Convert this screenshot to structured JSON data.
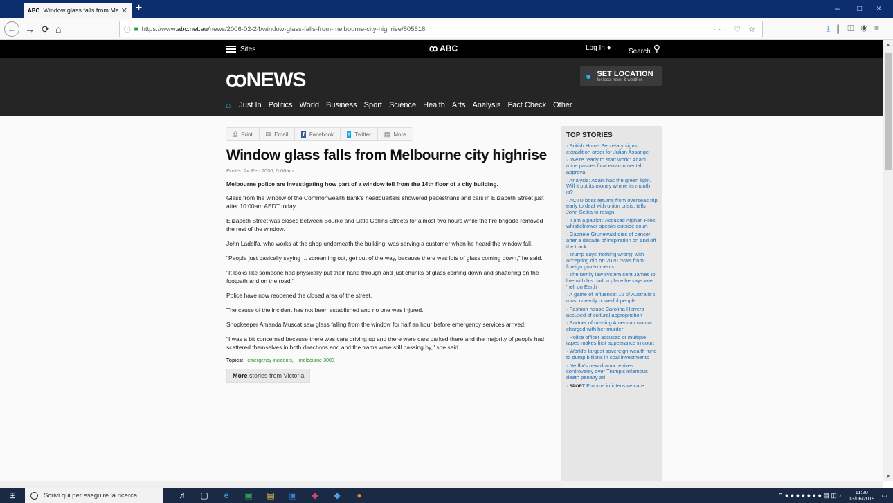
{
  "browser": {
    "tab_title": "Window glass falls from Melbo",
    "tab_favicon": "ABC",
    "url_prefix": "https://www.",
    "url_host": "abc.net.au",
    "url_path": "/news/2006-02-24/window-glass-falls-from-melbourne-city-highrise/805618",
    "url_menu": "··· ♡ ☆",
    "window_controls": [
      "–",
      "□",
      "×"
    ]
  },
  "abc_bar": {
    "sites": "Sites",
    "logo": "ABC",
    "login": "Log In",
    "search": "Search"
  },
  "news_header": {
    "logo": "NEWS",
    "set_location": "SET LOCATION",
    "set_location_sub": "for local news & weather",
    "nav": [
      "Just In",
      "Politics",
      "World",
      "Business",
      "Sport",
      "Science",
      "Health",
      "Arts",
      "Analysis",
      "Fact Check",
      "Other"
    ]
  },
  "share": {
    "print": "Print",
    "email": "Email",
    "facebook": "Facebook",
    "twitter": "Twitter",
    "more": "More"
  },
  "article": {
    "headline": "Window glass falls from Melbourne city highrise",
    "posted": "Posted 24 Feb 2006, 5:06am",
    "lead": "Melbourne police are investigating how part of a window fell from the 14th floor of a city building.",
    "paragraphs": [
      "Glass from the window of the Commonwealth Bank's headquarters showered pedestrians and cars in Elizabeth Street just after 10:00am AEDT today.",
      "Elizabeth Street was closed between Bourke and Little Collins Streets for almost two hours while the fire brigade removed the rest of the window.",
      "John Ladelfa, who works at the shop underneath the building, was serving a customer when he heard the window fall.",
      "\"People just basically saying ... screaming out, get out of the way, because there was lots of glass coming down,\" he said.",
      "\"It looks like someone had physically put their hand through and just chunks of glass coming down and shattering on the footpath and on the road.\"",
      "Police have now reopened the closed area of the street.",
      "The cause of the incident has not been established and no one was injured.",
      "Shopkeeper Amanda Muscat saw glass falling from the window for half an hour before emergency services arrived.",
      "\"I was a bit concerned because there was cars driving up and there were cars parked there and the majority of people had scattered themselves in both directions and and the trams were still passing by,\" she said."
    ],
    "topics_label": "Topics:",
    "topics": [
      "emergency-incidents,",
      "melbourne-3000"
    ],
    "more_bold": "More",
    "more_rest": " stories from Victoria"
  },
  "sidebar": {
    "title": "TOP STORIES",
    "stories": [
      "· British Home Secretary signs extradition order for Julian Assange",
      "· 'We're ready to start work': Adani mine passes final environmental approval",
      "· Analysis: Adani has the green light. Will it put its money where its mouth is?",
      "· ACTU boss returns from overseas trip early to deal with union crisis, tells John Setka to resign",
      "· 'I am a patriot': Accused Afghan Files whistleblower speaks outside court",
      "· Gabriele Grunewald dies of cancer after a decade of inspiration on and off the track",
      "· Trump says 'nothing wrong' with accepting dirt on 2020 rivals from foreign governments",
      "· The family law system sent James to live with his dad, a place he says was 'hell on Earth'",
      "· A game of influence: 10 of Australia's most covertly powerful people",
      "· Fashion house Carolina Herrera accused of cultural appropriation",
      "· Partner of missing American woman charged with her murder",
      "· Police officer accused of multiple rapes makes first appearance in court",
      "· World's largest sovereign wealth fund to dump billions in coal investments",
      "· Netflix's new drama revives controversy over Trump's infamous death penalty ad"
    ],
    "last_section": "SPORT",
    "last_story": "Froome in intensive care"
  },
  "taskbar": {
    "search_placeholder": "Scrivi qui per eseguire la ricerca",
    "time": "11:20",
    "date": "13/06/2019"
  }
}
